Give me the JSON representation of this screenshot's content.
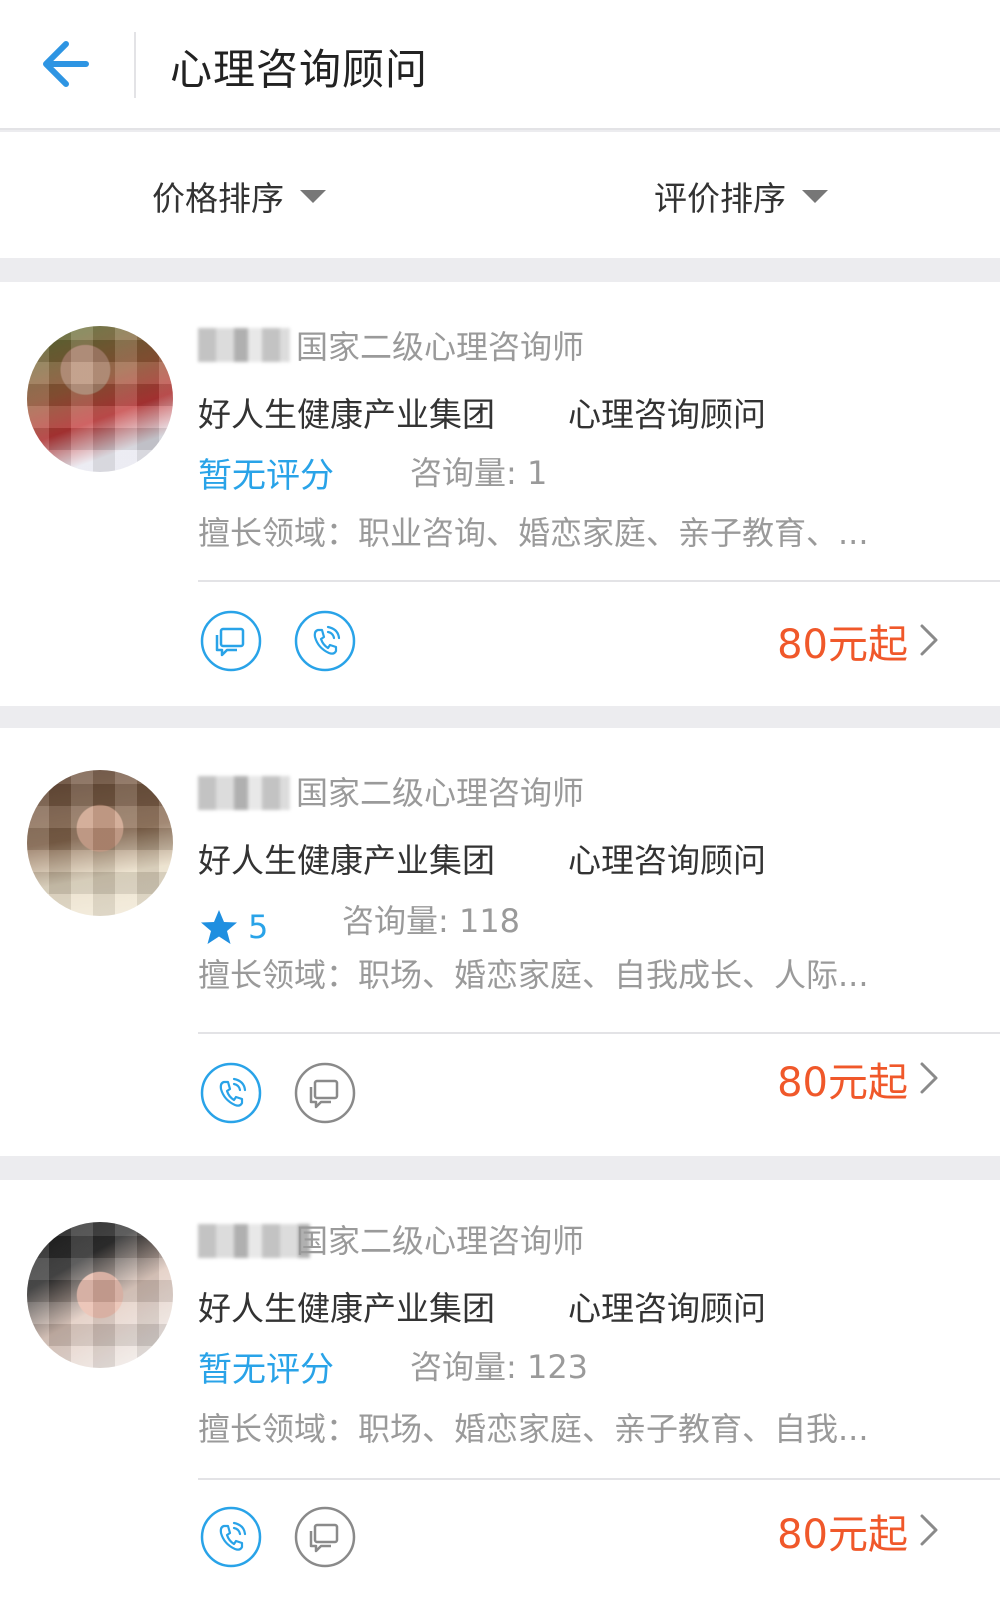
{
  "header": {
    "title": "心理咨询顾问"
  },
  "sort": {
    "price_label": "价格排序",
    "rating_label": "评价排序"
  },
  "counselors": [
    {
      "qualification": "国家二级心理咨询师",
      "org": "好人生健康产业集团",
      "role": "心理咨询顾问",
      "rating_text": "暂无评分",
      "consult_label": "咨询量: 1",
      "specialty": "擅长领域：职业咨询、婚恋家庭、亲子教育、...",
      "price": "80元起",
      "services": [
        "chat",
        "phone"
      ],
      "service_colors": [
        "#29a3e8",
        "#29a3e8"
      ]
    },
    {
      "qualification": "国家二级心理咨询师",
      "org": "好人生健康产业集团",
      "role": "心理咨询顾问",
      "rating_value": "5",
      "consult_label": "咨询量: 118",
      "specialty": "擅长领域：职场、婚恋家庭、自我成长、人际...",
      "price": "80元起",
      "services": [
        "phone",
        "chat"
      ],
      "service_colors": [
        "#29a3e8",
        "#8a8a8a"
      ]
    },
    {
      "qualification": "国家二级心理咨询师",
      "org": "好人生健康产业集团",
      "role": "心理咨询顾问",
      "rating_text": "暂无评分",
      "consult_label": "咨询量: 123",
      "specialty": "擅长领域：职场、婚恋家庭、亲子教育、自我...",
      "price": "80元起",
      "services": [
        "phone",
        "chat"
      ],
      "service_colors": [
        "#29a3e8",
        "#8a8a8a"
      ]
    }
  ],
  "colors": {
    "accent": "#29a3e8",
    "price": "#f0582a",
    "muted": "#9a9a9a"
  }
}
